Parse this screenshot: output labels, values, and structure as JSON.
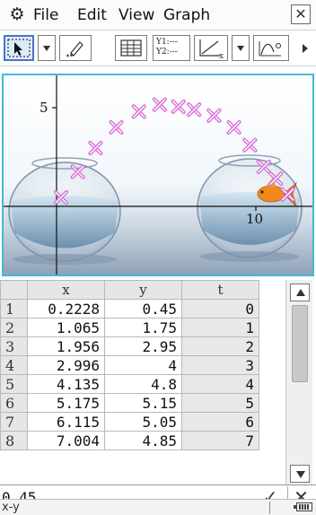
{
  "menu": {
    "gear_icon": "gear-icon",
    "items": [
      "File",
      "Edit",
      "View",
      "Graph"
    ],
    "close_label": "✕"
  },
  "toolbar": {
    "yeq_line1": "Y1:---",
    "yeq_line2": "Y2:---"
  },
  "graph": {
    "y_tick_label": "5",
    "x_tick_label": "10",
    "point_color": "#d96ad9"
  },
  "chart_data": {
    "type": "scatter",
    "x": [
      0.2228,
      1.065,
      1.956,
      2.996,
      4.135,
      5.175,
      6.115,
      6.9,
      7.9,
      8.9,
      9.7,
      10.4,
      11.0,
      11.6
    ],
    "y": [
      0.45,
      1.75,
      2.95,
      4,
      4.8,
      5.15,
      5.05,
      4.9,
      4.6,
      4.0,
      3.1,
      2.0,
      1.4,
      0.6
    ],
    "tick_labels": {
      "x": [
        "10"
      ],
      "y": [
        "5"
      ]
    },
    "grid": false
  },
  "table": {
    "headers": [
      "x",
      "y",
      "t"
    ],
    "rows": [
      {
        "n": "1",
        "x": "0.2228",
        "y": "0.45",
        "t": "0"
      },
      {
        "n": "2",
        "x": "1.065",
        "y": "1.75",
        "t": "1"
      },
      {
        "n": "3",
        "x": "1.956",
        "y": "2.95",
        "t": "2"
      },
      {
        "n": "4",
        "x": "2.996",
        "y": "4",
        "t": "3"
      },
      {
        "n": "5",
        "x": "4.135",
        "y": "4.8",
        "t": "4"
      },
      {
        "n": "6",
        "x": "5.175",
        "y": "5.15",
        "t": "5"
      },
      {
        "n": "7",
        "x": "6.115",
        "y": "5.05",
        "t": "6"
      },
      {
        "n": "8",
        "x": "7.004",
        "y": "4.85",
        "t": "7"
      }
    ]
  },
  "entry": {
    "value": "0.45"
  },
  "status": {
    "text": "x-y"
  }
}
